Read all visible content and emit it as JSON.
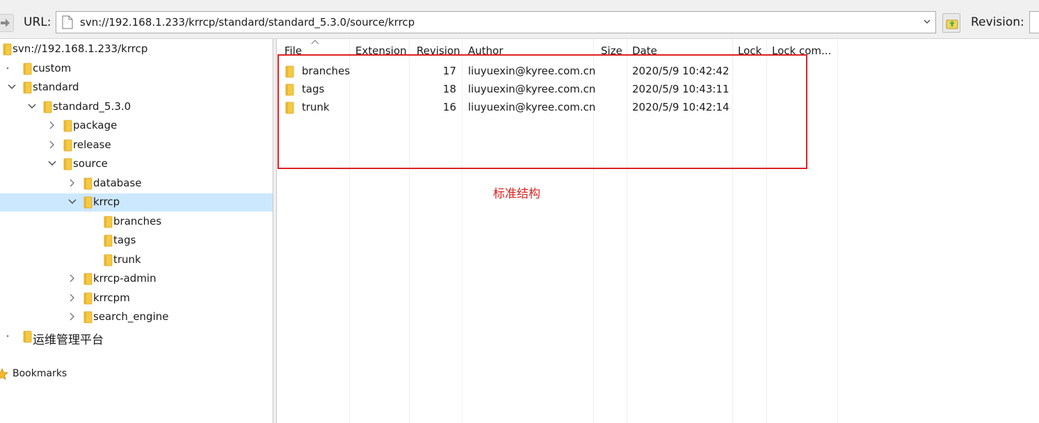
{
  "toolbar": {
    "url_label": "URL:",
    "url_value": "svn://192.168.1.233/krrcp/standard/standard_5.3.0/source/krrcp",
    "revision_label": "Revision:"
  },
  "tree": {
    "items": [
      {
        "label": "svn://192.168.1.233/krrcp",
        "level": 0,
        "expander": "none",
        "selected": false
      },
      {
        "label": "custom",
        "level": 1,
        "expander": "dot",
        "selected": false
      },
      {
        "label": "standard",
        "level": 1,
        "expander": "open",
        "selected": false
      },
      {
        "label": "standard_5.3.0",
        "level": 2,
        "expander": "open",
        "selected": false
      },
      {
        "label": "package",
        "level": 3,
        "expander": "closed",
        "selected": false
      },
      {
        "label": "release",
        "level": 3,
        "expander": "closed",
        "selected": false
      },
      {
        "label": "source",
        "level": 3,
        "expander": "open",
        "selected": false
      },
      {
        "label": "database",
        "level": 4,
        "expander": "closed",
        "selected": false
      },
      {
        "label": "krrcp",
        "level": 4,
        "expander": "open",
        "selected": true
      },
      {
        "label": "branches",
        "level": 5,
        "expander": "none",
        "selected": false
      },
      {
        "label": "tags",
        "level": 5,
        "expander": "none",
        "selected": false
      },
      {
        "label": "trunk",
        "level": 5,
        "expander": "none",
        "selected": false
      },
      {
        "label": "krrcp-admin",
        "level": 4,
        "expander": "closed",
        "selected": false
      },
      {
        "label": "krrcpm",
        "level": 4,
        "expander": "closed",
        "selected": false
      },
      {
        "label": "search_engine",
        "level": 4,
        "expander": "closed",
        "selected": false
      },
      {
        "label": "运维管理平台",
        "level": 1,
        "expander": "dot",
        "selected": false
      }
    ],
    "bookmarks_label": "Bookmarks"
  },
  "list": {
    "columns": [
      "File",
      "Extension",
      "Revision",
      "Author",
      "Size",
      "Date",
      "Lock",
      "Lock com..."
    ],
    "rows": [
      {
        "file": "branches",
        "extension": "",
        "revision": "17",
        "author": "liuyuexin@kyree.com.cn",
        "size": "",
        "date": "2020/5/9 10:42:42",
        "lock": ""
      },
      {
        "file": "tags",
        "extension": "",
        "revision": "18",
        "author": "liuyuexin@kyree.com.cn",
        "size": "",
        "date": "2020/5/9 10:43:11",
        "lock": ""
      },
      {
        "file": "trunk",
        "extension": "",
        "revision": "16",
        "author": "liuyuexin@kyree.com.cn",
        "size": "",
        "date": "2020/5/9 10:42:14",
        "lock": ""
      }
    ]
  },
  "annotation": {
    "text": "标准结构",
    "color": "#e02020"
  },
  "colors": {
    "folder": "#f6c944",
    "selection": "#cce8ff"
  }
}
